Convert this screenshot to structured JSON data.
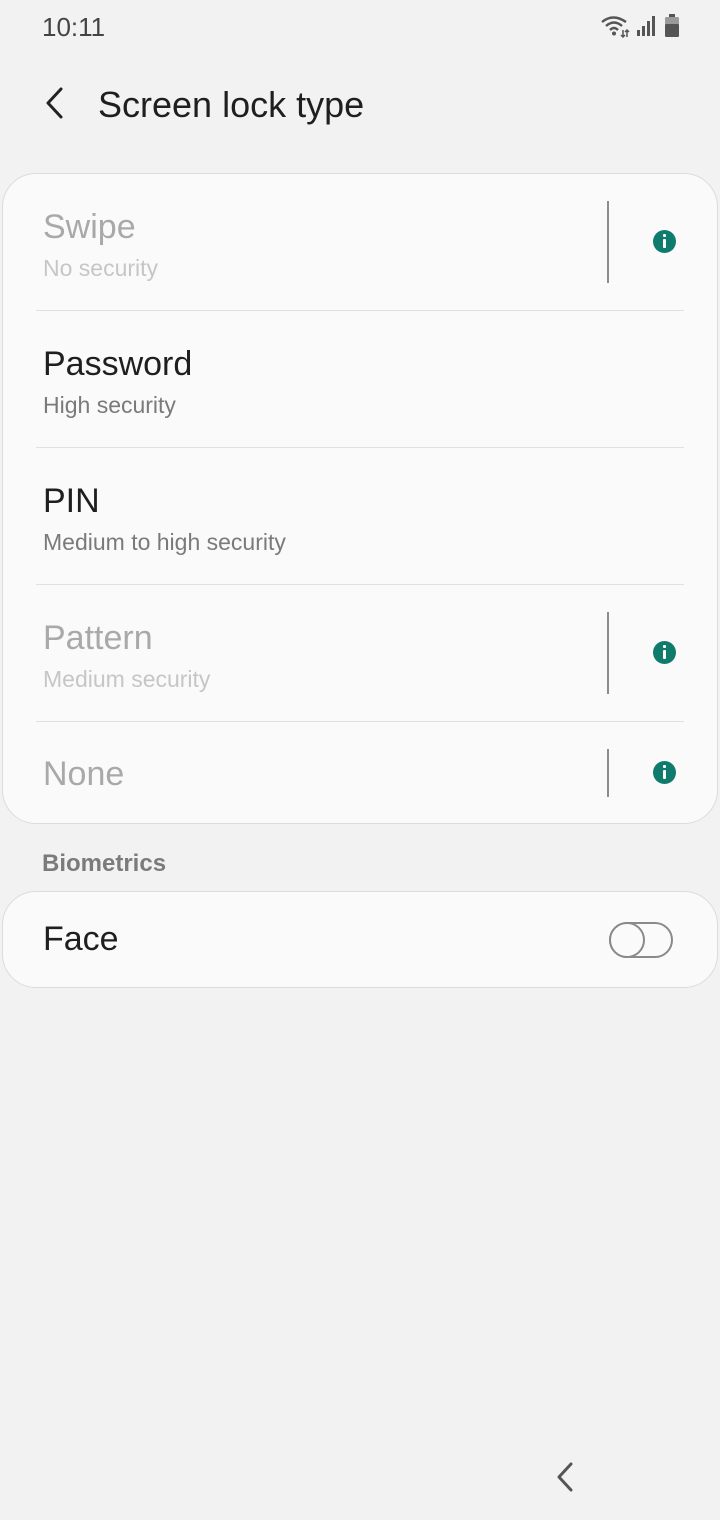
{
  "status_bar": {
    "time": "10:11",
    "icons": [
      "wifi-icon",
      "signal-icon",
      "battery-icon"
    ]
  },
  "header": {
    "title": "Screen lock type",
    "back_icon": "back-arrow-icon"
  },
  "lock_types": [
    {
      "title": "Swipe",
      "subtitle": "No security",
      "enabled": false,
      "has_info": true
    },
    {
      "title": "Password",
      "subtitle": "High security",
      "enabled": true,
      "has_info": false
    },
    {
      "title": "PIN",
      "subtitle": "Medium to high security",
      "enabled": true,
      "has_info": false
    },
    {
      "title": "Pattern",
      "subtitle": "Medium security",
      "enabled": false,
      "has_info": true
    },
    {
      "title": "None",
      "subtitle": "",
      "enabled": false,
      "has_info": true
    }
  ],
  "biometrics": {
    "section_title": "Biometrics",
    "face": {
      "label": "Face",
      "toggle_on": false
    }
  },
  "colors": {
    "background": "#f2f2f2",
    "card": "#fafafa",
    "info_accent": "#0f7b6c"
  },
  "nav_bar": {
    "back_icon": "nav-back-icon"
  }
}
